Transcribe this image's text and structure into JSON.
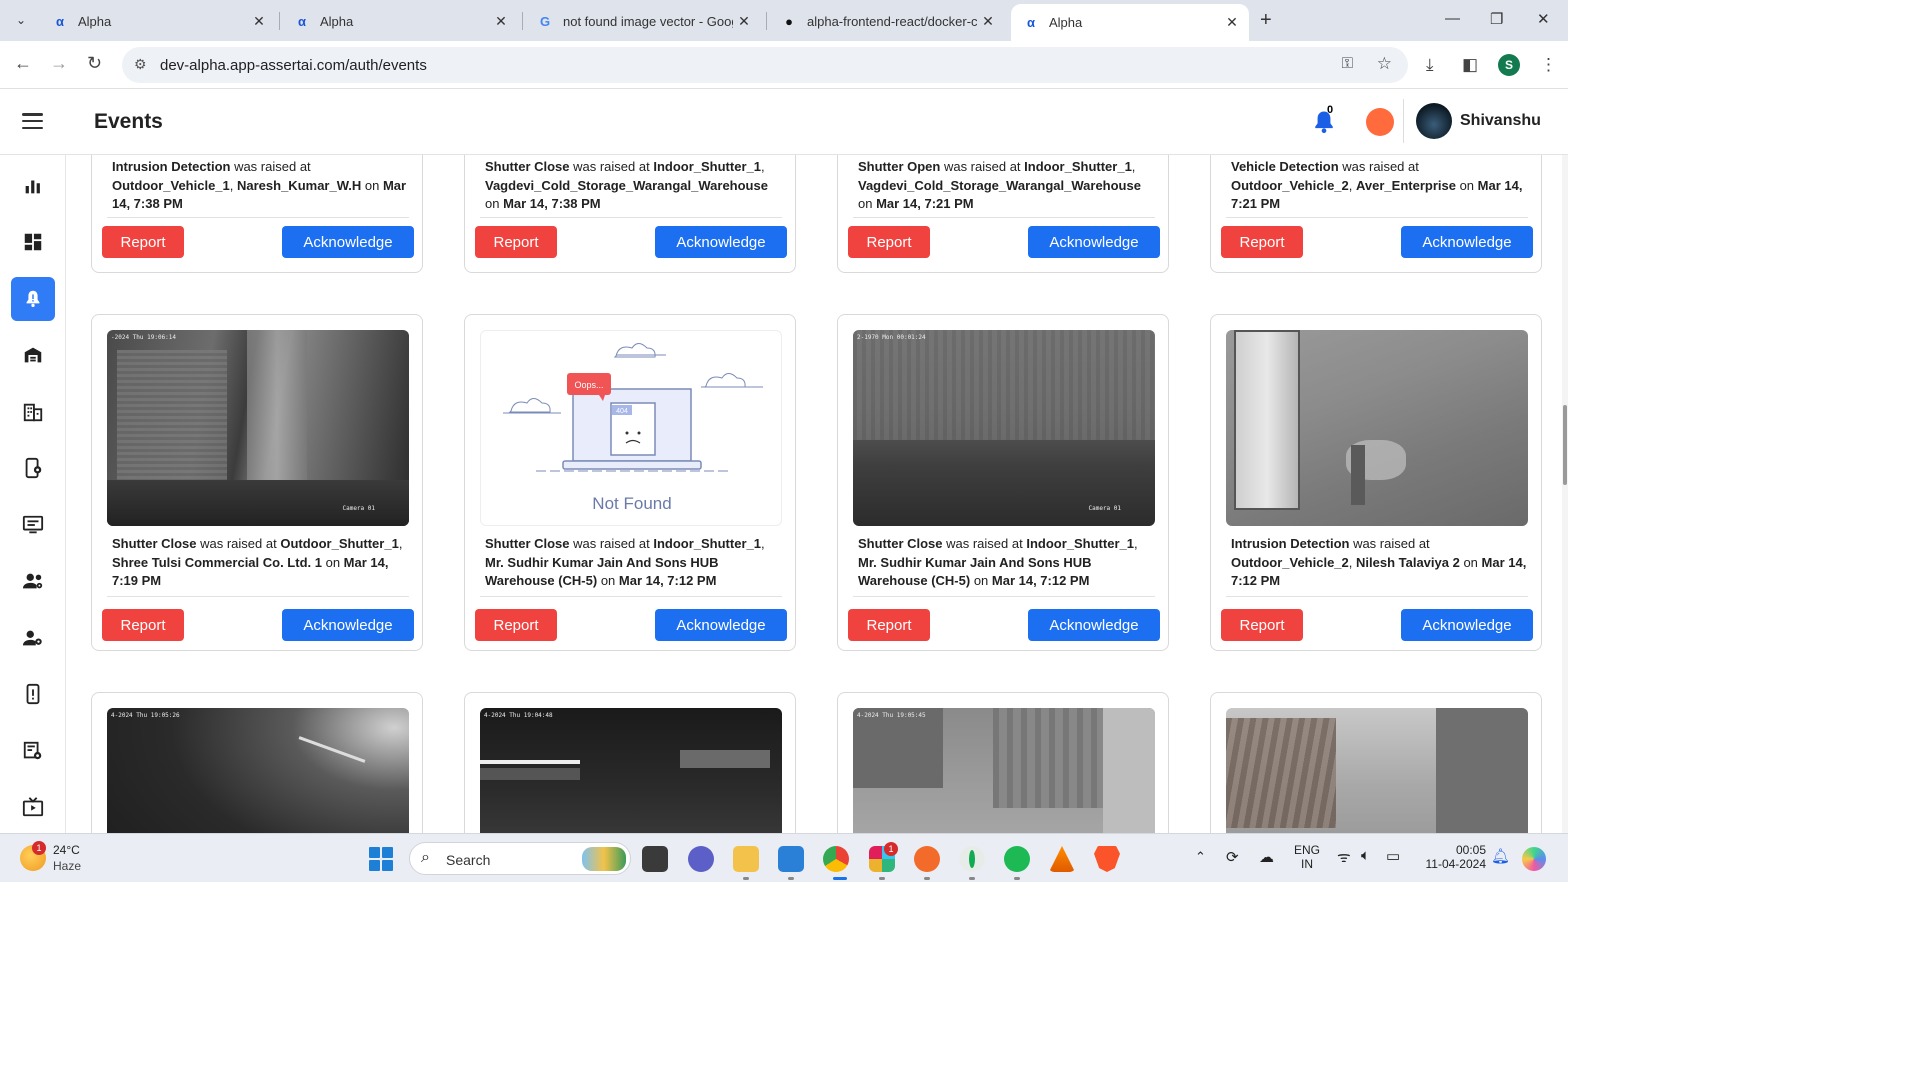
{
  "browser": {
    "tabs": [
      {
        "title": "Alpha",
        "favicon": "alpha-logo-icon",
        "active": false
      },
      {
        "title": "Alpha",
        "favicon": "alpha-logo-icon",
        "active": false
      },
      {
        "title": "not found image vector - Goog",
        "favicon": "google-icon",
        "active": false
      },
      {
        "title": "alpha-frontend-react/docker-cc",
        "favicon": "github-icon",
        "active": false
      },
      {
        "title": "Alpha",
        "favicon": "alpha-logo-icon",
        "active": true
      }
    ],
    "url": "dev-alpha.app-assertai.com/auth/events",
    "profile_initial": "S"
  },
  "header": {
    "title": "Events",
    "notification_count": "0",
    "user_name": "Shivanshu"
  },
  "colors": {
    "accent": "#2f7cf6",
    "report": "#f0433f",
    "acknowledge": "#1b6ff0"
  },
  "buttons": {
    "report": "Report",
    "acknowledge": "Acknowledge"
  },
  "sidebar": {
    "items": [
      {
        "icon": "bar-chart-icon",
        "active": false
      },
      {
        "icon": "dashboard-icon",
        "active": false
      },
      {
        "icon": "bell-alert-icon",
        "active": true
      },
      {
        "icon": "warehouse-icon",
        "active": false
      },
      {
        "icon": "building-icon",
        "active": false
      },
      {
        "icon": "device-settings-icon",
        "active": false
      },
      {
        "icon": "monitor-list-icon",
        "active": false
      },
      {
        "icon": "user-group-settings-icon",
        "active": false
      },
      {
        "icon": "user-settings-icon",
        "active": false
      },
      {
        "icon": "device-alert-icon",
        "active": false
      },
      {
        "icon": "cctv-config-icon",
        "active": false
      },
      {
        "icon": "video-feed-icon",
        "active": false
      }
    ]
  },
  "events_row_top": [
    {
      "event": "Intrusion Detection",
      "mid": " was raised at ",
      "camera": "Outdoor_Vehicle_1",
      "site": "Naresh_Kumar_W.H",
      "time": "Mar 14, 7:38 PM"
    },
    {
      "event": "Shutter Close",
      "mid": " was raised at ",
      "camera": "Indoor_Shutter_1",
      "site": "Vagdevi_Cold_Storage_Warangal_Warehouse",
      "time": "Mar 14, 7:38 PM"
    },
    {
      "event": "Shutter Open",
      "mid": " was raised at ",
      "camera": "Indoor_Shutter_1",
      "site": "Vagdevi_Cold_Storage_Warangal_Warehouse",
      "time": "Mar 14, 7:21 PM"
    },
    {
      "event": "Vehicle Detection",
      "mid": " was raised at ",
      "camera": "Outdoor_Vehicle_2",
      "site": "Aver_Enterprise",
      "time": "Mar 14, 7:21 PM"
    }
  ],
  "events_row_mid": [
    {
      "event": "Shutter Close",
      "mid": " was raised at ",
      "camera": "Outdoor_Shutter_1",
      "site": "Shree Tulsi Commercial Co. Ltd. 1",
      "time": "Mar 14, 7:19 PM",
      "timestamp": "-2024 Thu 19:06:14",
      "cam_label": "Camera 01"
    },
    {
      "event": "Shutter Close",
      "mid": " was raised at ",
      "camera": "Indoor_Shutter_1",
      "site": "Mr. Sudhir Kumar Jain And Sons HUB Warehouse (CH-5)",
      "time": "Mar 14, 7:12 PM",
      "not_found": "Not Found",
      "oops": "Oops...",
      "code": "404"
    },
    {
      "event": "Shutter Close",
      "mid": " was raised at ",
      "camera": "Indoor_Shutter_1",
      "site": "Mr. Sudhir Kumar Jain And Sons HUB Warehouse (CH-5)",
      "time": "Mar 14, 7:12 PM",
      "timestamp": "2-1970 Mon 00:01:24",
      "cam_label": "Camera 01"
    },
    {
      "event": "Intrusion Detection",
      "mid": " was raised at ",
      "camera": "Outdoor_Vehicle_2",
      "site": "Nilesh Talaviya 2",
      "time": "Mar 14, 7:12 PM"
    }
  ],
  "events_row_bottom": [
    {
      "timestamp": "4-2024 Thu 19:05:26"
    },
    {
      "timestamp": "4-2024 Thu 19:04:48"
    },
    {
      "timestamp": "4-2024 Thu 19:05:45"
    },
    {
      "timestamp": ""
    }
  ],
  "taskbar": {
    "weather_temp": "24°C",
    "weather_cond": "Haze",
    "weather_badge": "1",
    "search_label": "Search",
    "lang_line1": "ENG",
    "lang_line2": "IN",
    "time": "00:05",
    "date": "11-04-2024",
    "slack_badge": "1"
  }
}
